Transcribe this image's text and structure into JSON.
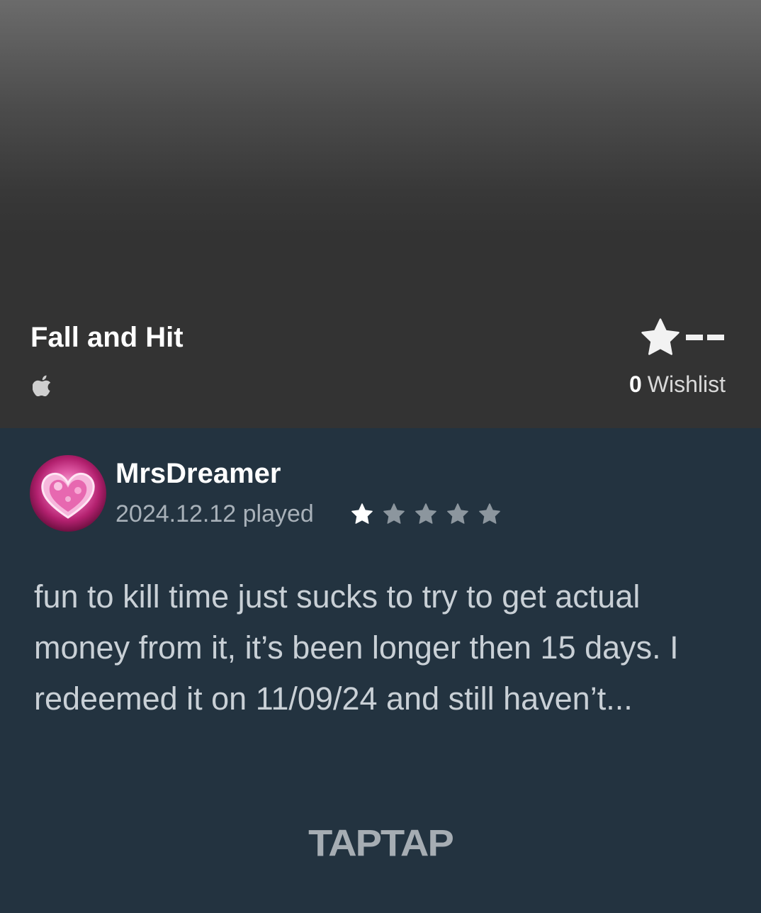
{
  "game": {
    "title": "Fall and Hit",
    "platform_icon": "apple-icon",
    "rating": "--",
    "wishlist_count": "0",
    "wishlist_label": "Wishlist"
  },
  "review": {
    "username": "MrsDreamer",
    "played_text": "2024.12.12 played",
    "stars_filled": 1,
    "stars_total": 5,
    "text": "fun to kill time just sucks to try to get actual money from it, it’s been longer then 15 days. I redeemed it on 11/09/24 and still haven’t..."
  },
  "brand": {
    "logo_text": "TAPTAP"
  },
  "colors": {
    "header_bg": "#333333",
    "review_bg": "#233340",
    "star_filled": "#ffffff",
    "star_empty": "#8c969e",
    "logo": "#a6adb3"
  }
}
